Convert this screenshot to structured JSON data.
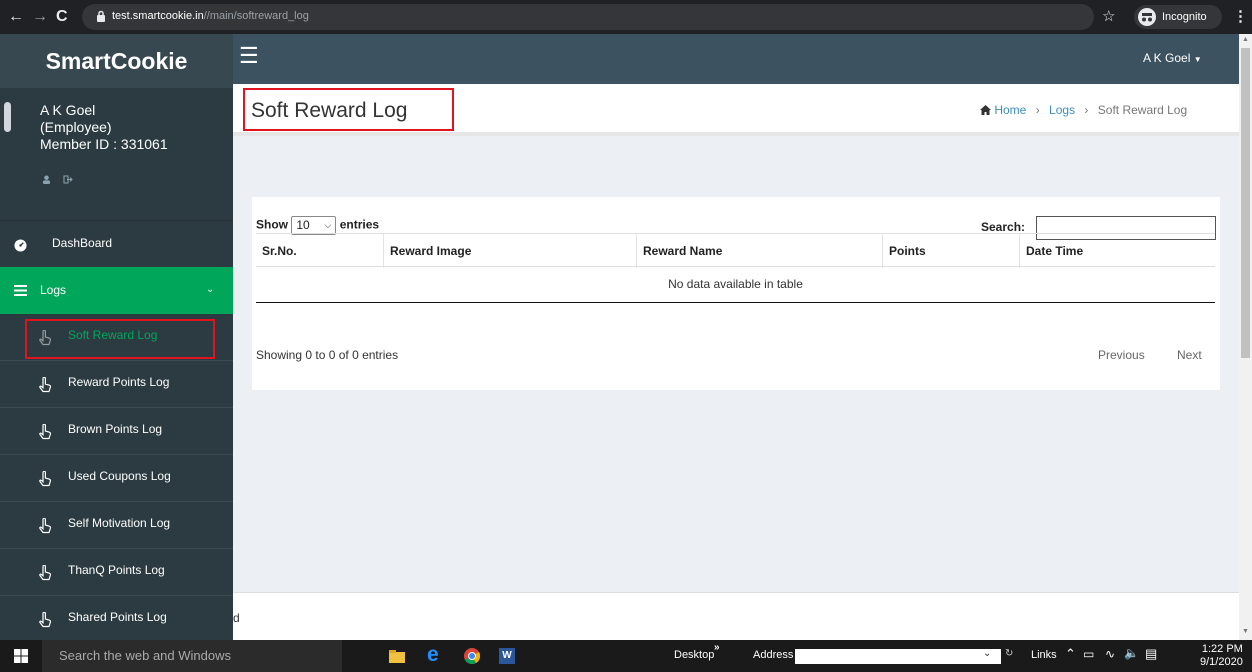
{
  "browser": {
    "url_host": "test.smartcookie.in",
    "url_path": "//main/softreward_log",
    "mode_label": "Incognito"
  },
  "app": {
    "brand": "SmartCookie",
    "user_menu_label": "A K Goel",
    "accent_color": "#00a65a",
    "highlight_box_color": "#e0141e"
  },
  "sidebar": {
    "user_name": "A K Goel",
    "user_role": "(Employee)",
    "member_id": "Member ID : 331061",
    "dashboard_label": "DashBoard",
    "logs_label": "Logs",
    "items": [
      {
        "label": "Soft Reward Log",
        "active": true
      },
      {
        "label": "Reward Points Log"
      },
      {
        "label": "Brown Points Log"
      },
      {
        "label": "Used Coupons Log"
      },
      {
        "label": "Self Motivation Log"
      },
      {
        "label": "ThanQ Points Log"
      },
      {
        "label": "Shared Points Log"
      }
    ]
  },
  "page": {
    "title": "Soft Reward Log",
    "breadcrumb": {
      "home": "Home",
      "sep": "›",
      "logs": "Logs",
      "current": "Soft Reward Log"
    }
  },
  "table": {
    "show_label": "Show",
    "entries_label": "entries",
    "page_size": "10",
    "search_label": "Search:",
    "columns": [
      "Sr.No.",
      "Reward Image",
      "Reward Name",
      "Points",
      "Date Time"
    ],
    "empty_message": "No data available in table",
    "info": "Showing 0 to 0 of 0 entries",
    "prev_label": "Previous",
    "next_label": "Next"
  },
  "footer": {
    "fragment": "d"
  },
  "taskbar": {
    "search_placeholder": "Search the web and Windows",
    "desktop_label": "Desktop",
    "address_label": "Address",
    "links_label": "Links",
    "time": "1:22 PM",
    "date": "9/1/2020"
  }
}
